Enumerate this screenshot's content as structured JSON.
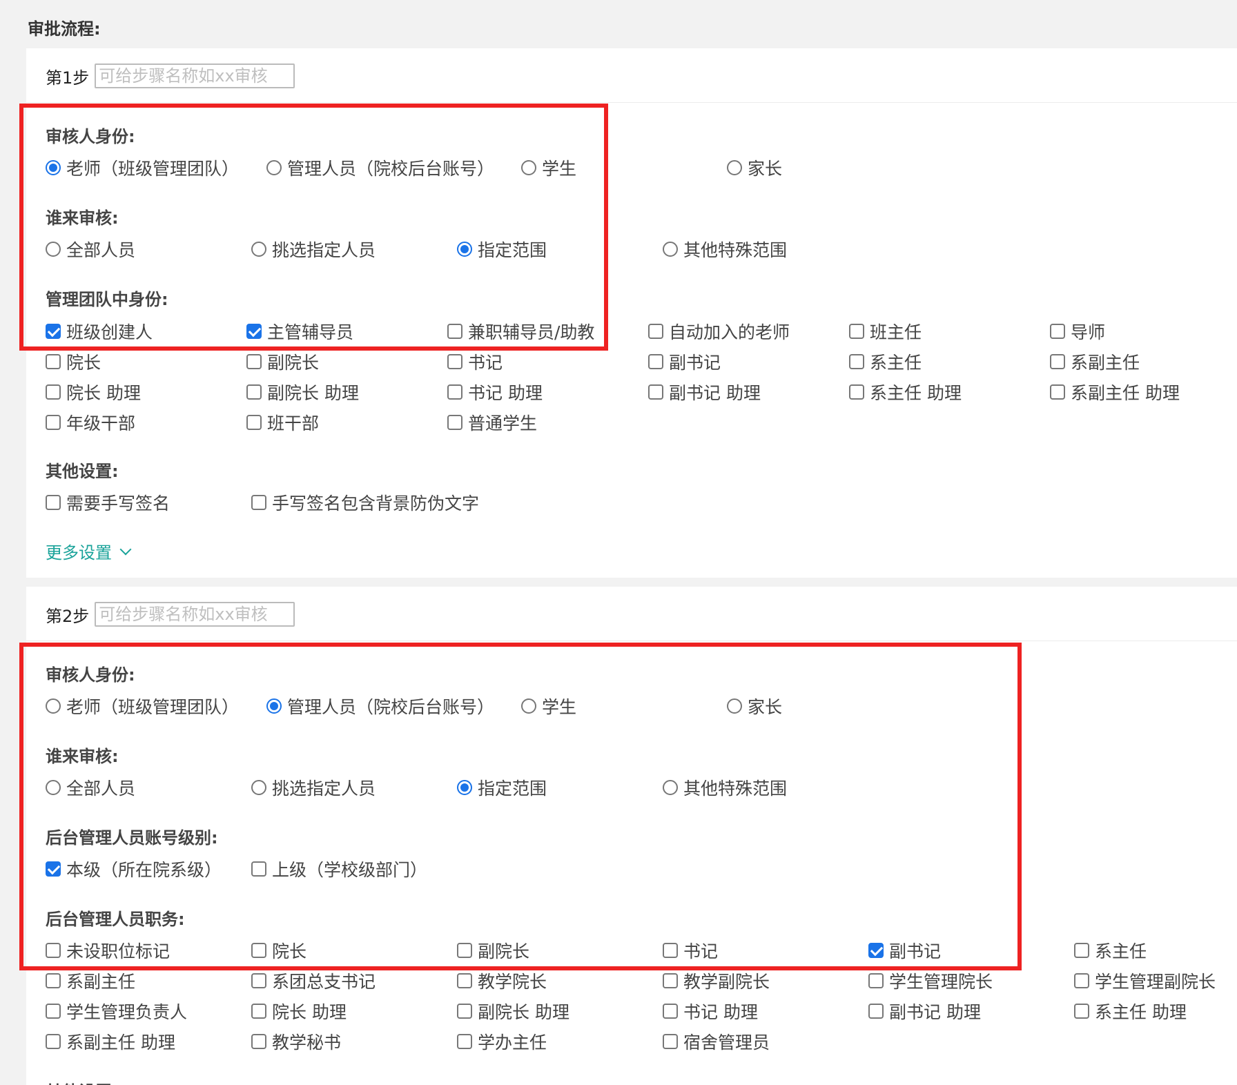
{
  "page_title": "审批流程:",
  "step_placeholder": "可给步骤名称如xx审核",
  "steps": [
    {
      "label": "第1步",
      "reviewer_identity": {
        "label": "审核人身份:",
        "options": [
          "老师（班级管理团队）",
          "管理人员（院校后台账号）",
          "学生",
          "家长"
        ],
        "selected": 0
      },
      "who_reviews": {
        "label": "谁来审核:",
        "options": [
          "全部人员",
          "挑选指定人员",
          "指定范围",
          "其他特殊范围"
        ],
        "selected": 2
      },
      "team_identity": {
        "label": "管理团队中身份:",
        "options": [
          {
            "text": "班级创建人",
            "checked": true
          },
          {
            "text": "主管辅导员",
            "checked": true
          },
          {
            "text": "兼职辅导员/助教",
            "checked": false
          },
          {
            "text": "自动加入的老师",
            "checked": false
          },
          {
            "text": "班主任",
            "checked": false
          },
          {
            "text": "导师",
            "checked": false
          },
          {
            "text": "院长",
            "checked": false
          },
          {
            "text": "副院长",
            "checked": false
          },
          {
            "text": "书记",
            "checked": false
          },
          {
            "text": "副书记",
            "checked": false
          },
          {
            "text": "系主任",
            "checked": false
          },
          {
            "text": "系副主任",
            "checked": false
          },
          {
            "text": "院长 助理",
            "checked": false
          },
          {
            "text": "副院长 助理",
            "checked": false
          },
          {
            "text": "书记 助理",
            "checked": false
          },
          {
            "text": "副书记 助理",
            "checked": false
          },
          {
            "text": "系主任 助理",
            "checked": false
          },
          {
            "text": "系副主任 助理",
            "checked": false
          },
          {
            "text": "年级干部",
            "checked": false
          },
          {
            "text": "班干部",
            "checked": false
          },
          {
            "text": "普通学生",
            "checked": false
          }
        ]
      },
      "other_settings": {
        "label": "其他设置:",
        "options": [
          {
            "text": "需要手写签名",
            "checked": false
          },
          {
            "text": "手写签名包含背景防伪文字",
            "checked": false
          }
        ]
      },
      "more_settings": "更多设置"
    },
    {
      "label": "第2步",
      "reviewer_identity": {
        "label": "审核人身份:",
        "options": [
          "老师（班级管理团队）",
          "管理人员（院校后台账号）",
          "学生",
          "家长"
        ],
        "selected": 1
      },
      "who_reviews": {
        "label": "谁来审核:",
        "options": [
          "全部人员",
          "挑选指定人员",
          "指定范围",
          "其他特殊范围"
        ],
        "selected": 2
      },
      "account_level": {
        "label": "后台管理人员账号级别:",
        "options": [
          {
            "text": "本级（所在院系级）",
            "checked": true
          },
          {
            "text": "上级（学校级部门）",
            "checked": false
          }
        ]
      },
      "admin_duty": {
        "label": "后台管理人员职务:",
        "options": [
          {
            "text": "未设职位标记",
            "checked": false
          },
          {
            "text": "院长",
            "checked": false
          },
          {
            "text": "副院长",
            "checked": false
          },
          {
            "text": "书记",
            "checked": false
          },
          {
            "text": "副书记",
            "checked": true
          },
          {
            "text": "系主任",
            "checked": false
          },
          {
            "text": "系副主任",
            "checked": false
          },
          {
            "text": "系团总支书记",
            "checked": false
          },
          {
            "text": "教学院长",
            "checked": false
          },
          {
            "text": "教学副院长",
            "checked": false
          },
          {
            "text": "学生管理院长",
            "checked": false
          },
          {
            "text": "学生管理副院长",
            "checked": false
          },
          {
            "text": "学生管理负责人",
            "checked": false
          },
          {
            "text": "院长 助理",
            "checked": false
          },
          {
            "text": "副院长 助理",
            "checked": false
          },
          {
            "text": "书记 助理",
            "checked": false
          },
          {
            "text": "副书记 助理",
            "checked": false
          },
          {
            "text": "系主任 助理",
            "checked": false
          },
          {
            "text": "系副主任 助理",
            "checked": false
          },
          {
            "text": "教学秘书",
            "checked": false
          },
          {
            "text": "学办主任",
            "checked": false
          },
          {
            "text": "宿舍管理员",
            "checked": false
          }
        ]
      },
      "other_settings_label": "其他设置:"
    }
  ],
  "colors": {
    "accent": "#1a73e8",
    "highlight": "#ee2222",
    "link": "#1aa39a"
  }
}
